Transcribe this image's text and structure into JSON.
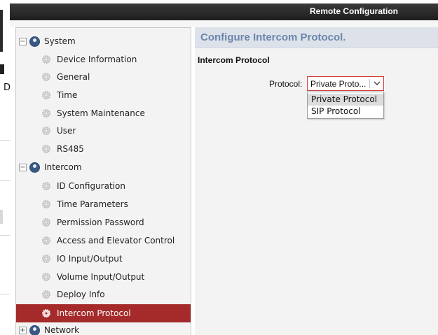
{
  "window": {
    "title": "Remote Configuration"
  },
  "tree": {
    "system": {
      "label": "System",
      "items": [
        "Device Information",
        "General",
        "Time",
        "System Maintenance",
        "User",
        "RS485"
      ]
    },
    "intercom": {
      "label": "Intercom",
      "items": [
        "ID Configuration",
        "Time Parameters",
        "Permission Password",
        "Access and Elevator Control",
        "IO Input/Output",
        "Volume Input/Output",
        "Deploy Info",
        "Intercom Protocol"
      ],
      "selected": "Intercom Protocol"
    },
    "network": {
      "label": "Network"
    }
  },
  "main": {
    "header": "Configure Intercom Protocol.",
    "section_title": "Intercom Protocol",
    "protocol_label": "Protocol:",
    "protocol_value": "Private Proto...",
    "options": [
      "Private Protocol",
      "SIP Protocol"
    ]
  },
  "left_edge_glyph": "D",
  "colors": {
    "accent_selected": "#a52a2a",
    "header_text": "#6b86ac",
    "select_border": "#d33a3a"
  },
  "icons": {
    "group": "globe-gear-icon",
    "leaf": "gear-icon",
    "expand": "plus-icon",
    "collapse": "minus-icon",
    "chevron": "chevron-down-icon"
  }
}
